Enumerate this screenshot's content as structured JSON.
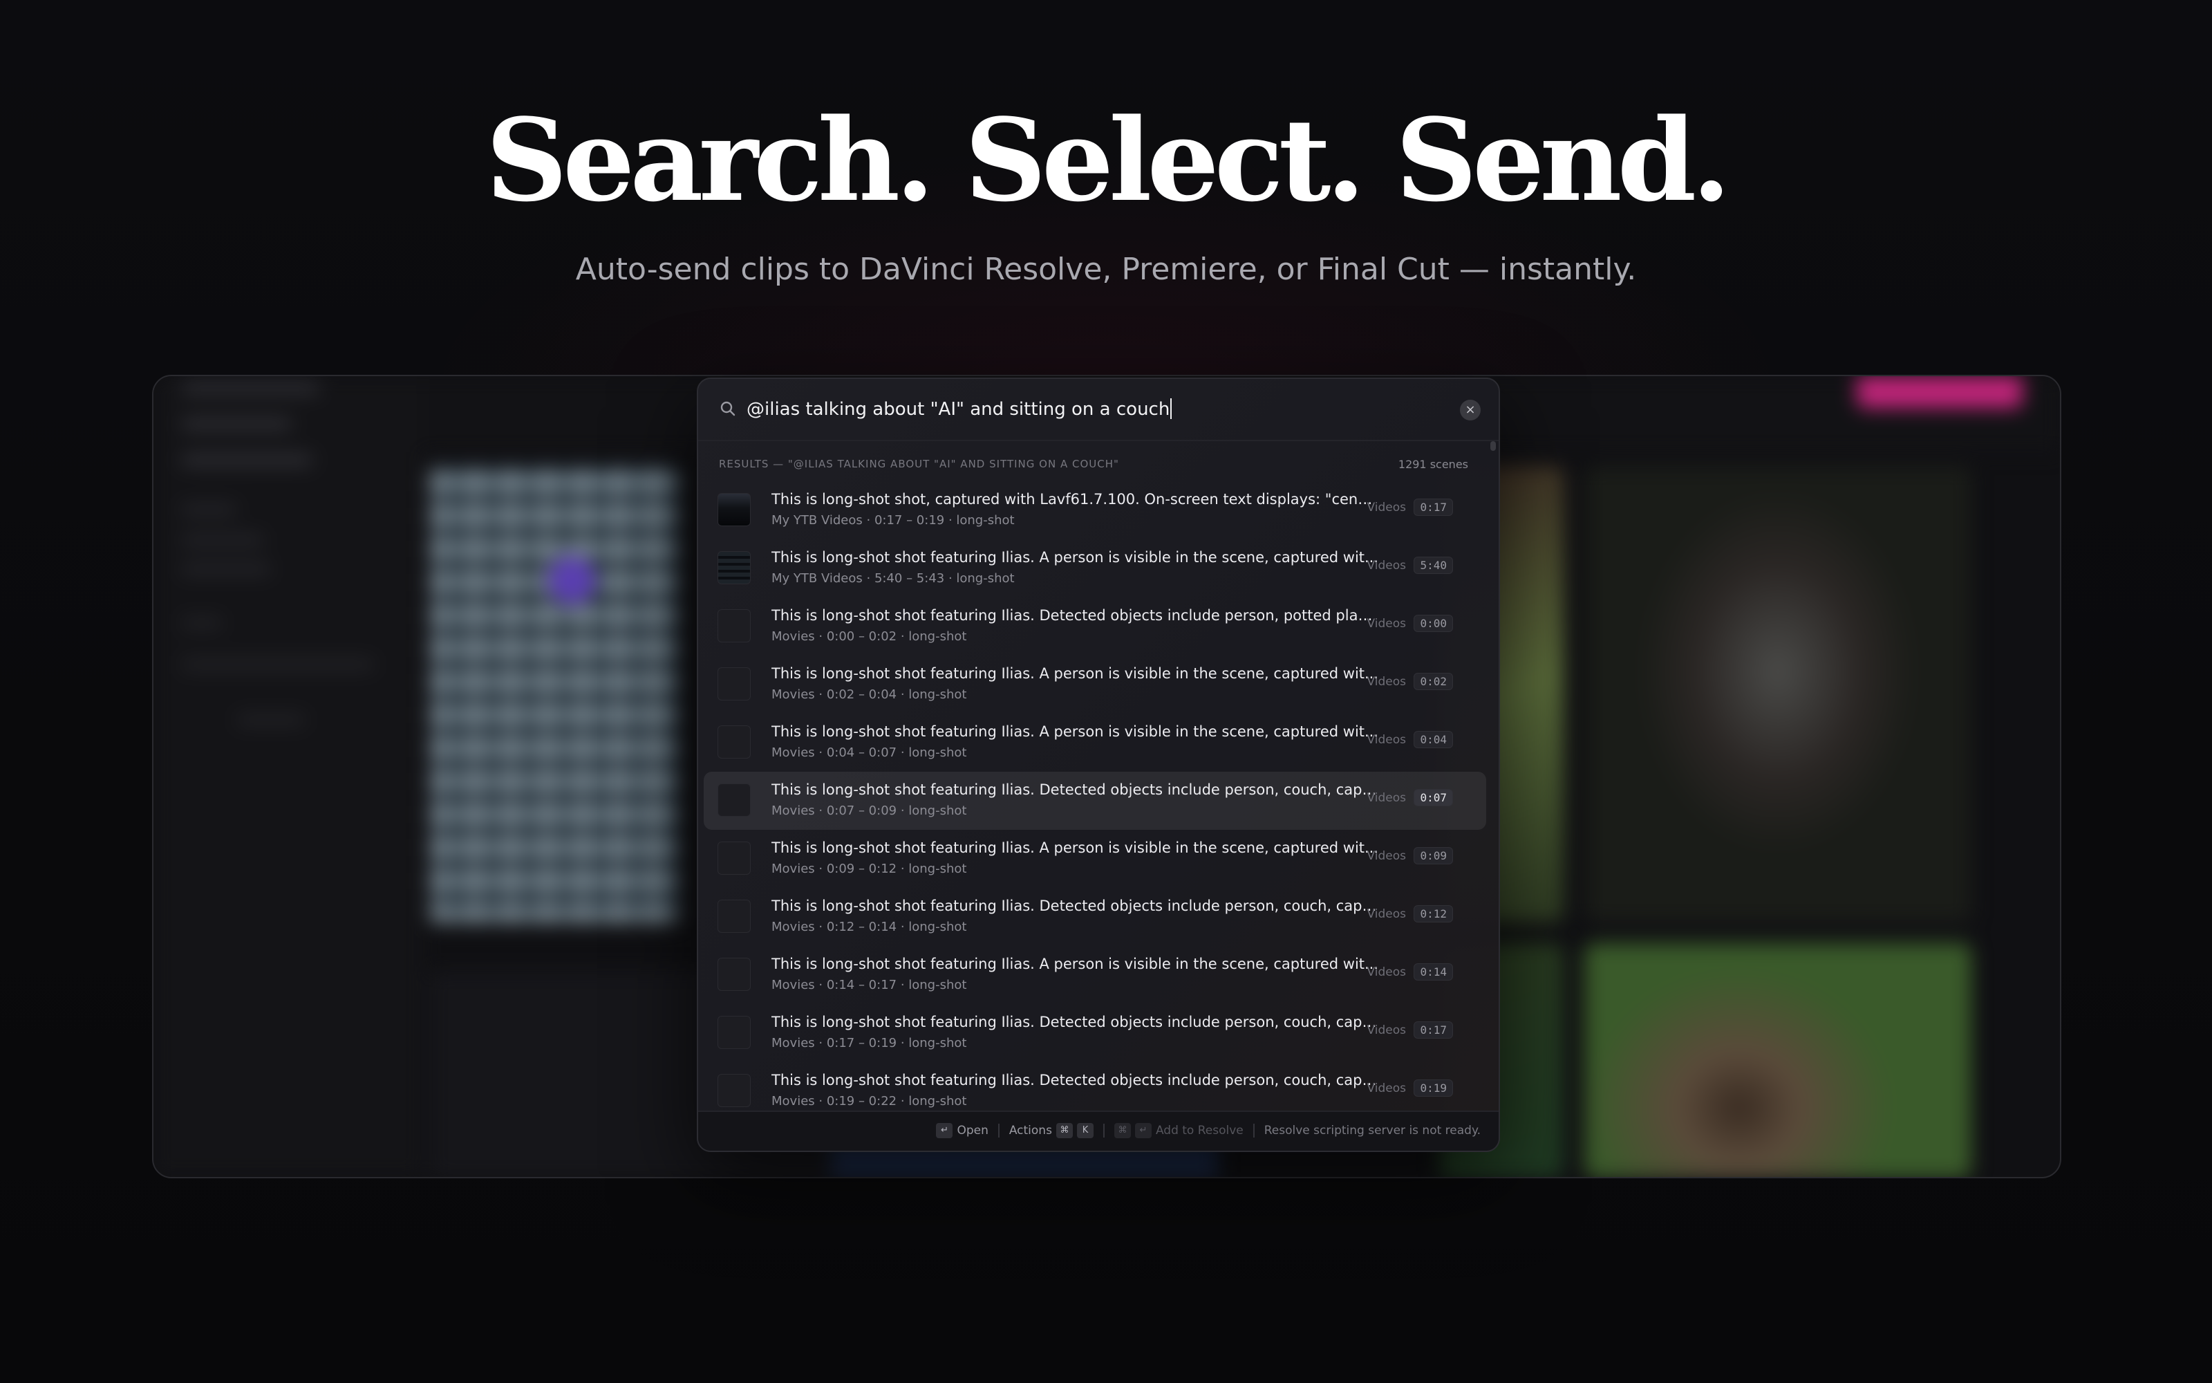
{
  "hero": {
    "title": "Search. Select. Send.",
    "subtitle": "Auto-send clips to DaVinci Resolve, Premiere, or Final Cut — instantly."
  },
  "palette": {
    "search": {
      "value": "@ilias talking about \"AI\" and sitting on a couch"
    },
    "results_label": "RESULTS — \"@ILIAS TALKING ABOUT \"AI\" AND SITTING ON A COUCH\"",
    "results_count": "1291 scenes",
    "results": [
      {
        "title": "This is long-shot shot, captured with Lavf61.7.100. On-screen text displays: \"cenes...",
        "meta": "My YTB Videos · 0:17 – 0:19 · long-shot",
        "source": "Videos",
        "time": "0:17",
        "thumb": "img"
      },
      {
        "title": "This is long-shot shot featuring Ilias. A person is visible in the scene, captured wit...",
        "meta": "My YTB Videos · 5:40 – 5:43 · long-shot",
        "source": "Videos",
        "time": "5:40",
        "thumb": "img2"
      },
      {
        "title": "This is long-shot shot featuring Ilias. Detected objects include person, potted plan...",
        "meta": "Movies · 0:00 – 0:02 · long-shot",
        "source": "Videos",
        "time": "0:00",
        "thumb": "none"
      },
      {
        "title": "This is long-shot shot featuring Ilias. A person is visible in the scene, captured wit...",
        "meta": "Movies · 0:02 – 0:04 · long-shot",
        "source": "Videos",
        "time": "0:02",
        "thumb": "none"
      },
      {
        "title": "This is long-shot shot featuring Ilias. A person is visible in the scene, captured wit...",
        "meta": "Movies · 0:04 – 0:07 · long-shot",
        "source": "Videos",
        "time": "0:04",
        "thumb": "none"
      },
      {
        "title": "This is long-shot shot featuring Ilias. Detected objects include person, couch, capt...",
        "meta": "Movies · 0:07 – 0:09 · long-shot",
        "source": "Videos",
        "time": "0:07",
        "thumb": "none",
        "selected": true
      },
      {
        "title": "This is long-shot shot featuring Ilias. A person is visible in the scene, captured wit...",
        "meta": "Movies · 0:09 – 0:12 · long-shot",
        "source": "Videos",
        "time": "0:09",
        "thumb": "none"
      },
      {
        "title": "This is long-shot shot featuring Ilias. Detected objects include person, couch, capt...",
        "meta": "Movies · 0:12 – 0:14 · long-shot",
        "source": "Videos",
        "time": "0:12",
        "thumb": "none"
      },
      {
        "title": "This is long-shot shot featuring Ilias. A person is visible in the scene, captured wit...",
        "meta": "Movies · 0:14 – 0:17 · long-shot",
        "source": "Videos",
        "time": "0:14",
        "thumb": "none"
      },
      {
        "title": "This is long-shot shot featuring Ilias. Detected objects include person, couch, capt...",
        "meta": "Movies · 0:17 – 0:19 · long-shot",
        "source": "Videos",
        "time": "0:17",
        "thumb": "none"
      },
      {
        "title": "This is long-shot shot featuring Ilias. Detected objects include person, couch, capt...",
        "meta": "Movies · 0:19 – 0:22 · long-shot",
        "source": "Videos",
        "time": "0:19",
        "thumb": "none"
      }
    ],
    "footer": {
      "open_key": "↵",
      "open_label": "Open",
      "actions_label": "Actions",
      "actions_key1": "⌘",
      "actions_key2": "K",
      "add_key1": "⌘",
      "add_key2": "↵",
      "add_label": "Add to Resolve",
      "status": "Resolve scripting server is not ready."
    },
    "clear_icon": "×"
  },
  "colors": {
    "accent_pink": "#c0257a",
    "background": "#0b0b0d"
  }
}
